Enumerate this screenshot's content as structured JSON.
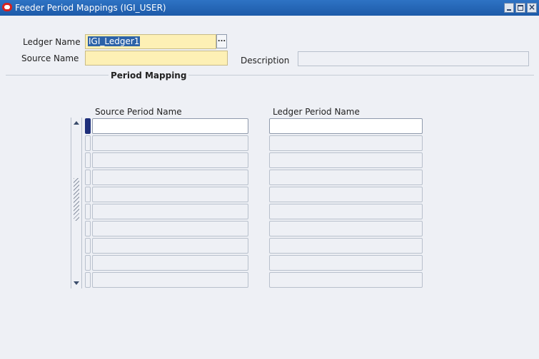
{
  "window": {
    "title": "Feeder Period Mappings (IGI_USER)"
  },
  "header": {
    "ledger_label": "Ledger Name",
    "ledger_value": "IGI_Ledger1",
    "lov_button": "...",
    "source_label": "Source Name",
    "source_value": "",
    "description_label": "Description",
    "description_value": ""
  },
  "mapping": {
    "section_title": "Period Mapping",
    "columns": [
      "Source Period Name",
      "Ledger Period Name"
    ],
    "rows": [
      {
        "source": "",
        "ledger": ""
      },
      {
        "source": "",
        "ledger": ""
      },
      {
        "source": "",
        "ledger": ""
      },
      {
        "source": "",
        "ledger": ""
      },
      {
        "source": "",
        "ledger": ""
      },
      {
        "source": "",
        "ledger": ""
      },
      {
        "source": "",
        "ledger": ""
      },
      {
        "source": "",
        "ledger": ""
      },
      {
        "source": "",
        "ledger": ""
      },
      {
        "source": "",
        "ledger": ""
      }
    ]
  },
  "colors": {
    "required_field": "#fdf0b5",
    "title_bar": "#1d5aa8",
    "selection": "#2d63a8"
  }
}
